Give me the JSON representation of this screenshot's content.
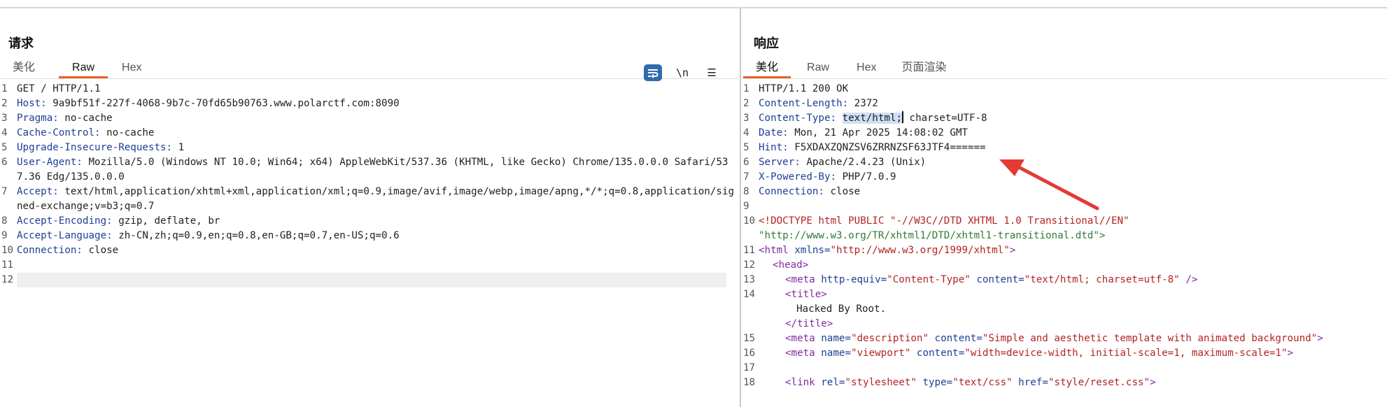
{
  "request": {
    "title": "请求",
    "tabs": [
      "美化",
      "Raw",
      "Hex"
    ],
    "active_tab": "Raw",
    "toolbar": {
      "wrap_icon": "wrap-lines-icon",
      "newline_label": "\\n",
      "menu_label": "☰"
    },
    "lines": [
      {
        "n": "1",
        "name": "",
        "value": "GET / HTTP/1.1"
      },
      {
        "n": "2",
        "name": "Host:",
        "value": " 9a9bf51f-227f-4068-9b7c-70fd65b90763.www.polarctf.com:8090"
      },
      {
        "n": "3",
        "name": "Pragma:",
        "value": " no-cache"
      },
      {
        "n": "4",
        "name": "Cache-Control:",
        "value": " no-cache"
      },
      {
        "n": "5",
        "name": "Upgrade-Insecure-Requests:",
        "value": " 1"
      },
      {
        "n": "6",
        "name": "User-Agent:",
        "value": " Mozilla/5.0 (Windows NT 10.0; Win64; x64) AppleWebKit/537.36 (KHTML, like Gecko) Chrome/135.0.0.0 Safari/537.36 Edg/135.0.0.0"
      },
      {
        "n": "7",
        "name": "Accept:",
        "value": " text/html,application/xhtml+xml,application/xml;q=0.9,image/avif,image/webp,image/apng,*/*;q=0.8,application/signed-exchange;v=b3;q=0.7"
      },
      {
        "n": "8",
        "name": "Accept-Encoding:",
        "value": " gzip, deflate, br"
      },
      {
        "n": "9",
        "name": "Accept-Language:",
        "value": " zh-CN,zh;q=0.9,en;q=0.8,en-GB;q=0.7,en-US;q=0.6"
      },
      {
        "n": "10",
        "name": "Connection:",
        "value": " close"
      },
      {
        "n": "11",
        "name": "",
        "value": ""
      },
      {
        "n": "12",
        "name": "",
        "value": ""
      }
    ]
  },
  "response": {
    "title": "响应",
    "tabs": [
      "美化",
      "Raw",
      "Hex",
      "页面渲染"
    ],
    "active_tab": "美化",
    "status_line": "HTTP/1.1 200 OK",
    "headers": [
      {
        "n": "2",
        "name": "Content-Length:",
        "value": " 2372"
      },
      {
        "n": "4",
        "name": "Date:",
        "value": " Mon, 21 Apr 2025 14:08:02 GMT"
      },
      {
        "n": "5",
        "name": "Hint:",
        "value": " F5XDAXZQNZSV6ZRRNZSF63JTF4======"
      },
      {
        "n": "6",
        "name": "Server:",
        "value": " Apache/2.4.23 (Unix)"
      },
      {
        "n": "7",
        "name": "X-Powered-By:",
        "value": " PHP/7.0.9"
      },
      {
        "n": "8",
        "name": "Connection:",
        "value": " close"
      }
    ],
    "content_type": {
      "name": "Content-Type:",
      "selected": "text/html;",
      "rest": " charset=UTF-8"
    },
    "doctype_1": "<!DOCTYPE html PUBLIC \"-//W3C//DTD XHTML 1.0 Transitional//EN\"",
    "doctype_2": "\"http://www.w3.org/TR/xhtml1/DTD/xhtml1-transitional.dtd\">",
    "html_open": {
      "tag": "<html",
      "attr": " xmlns=",
      "val": "\"http://www.w3.org/1999/xhtml\"",
      "close": ">"
    },
    "head_open": "<head>",
    "meta_ct": {
      "tag": "<meta",
      "a1": " http-equiv=",
      "v1": "\"Content-Type\"",
      "a2": " content=",
      "v2": "\"text/html; charset=utf-8\"",
      "close": " />"
    },
    "title_open": "<title>",
    "title_text": "Hacked By Root.",
    "title_close": "</title>",
    "meta_desc": {
      "tag": "<meta",
      "a1": " name=",
      "v1": "\"description\"",
      "a2": " content=",
      "v2": "\"Simple and aesthetic template with animated background\"",
      "close": ">"
    },
    "meta_vp": {
      "tag": "<meta",
      "a1": " name=",
      "v1": "\"viewport\"",
      "a2": " content=",
      "v2": "\"width=device-width, initial-scale=1, maximum-scale=1\"",
      "close": ">"
    },
    "link_css": {
      "tag": "<link",
      "a1": " rel=",
      "v1": "\"stylesheet\"",
      "a2": " type=",
      "v2": "\"text/css\"",
      "a3": " href=",
      "v3": "\"style/reset.css\"",
      "close": ">"
    }
  },
  "colors": {
    "accent": "#e8602c",
    "header_name": "#1e3f96",
    "tag": "#7f2a9e",
    "string": "#b32424",
    "arrow": "#e53935"
  }
}
